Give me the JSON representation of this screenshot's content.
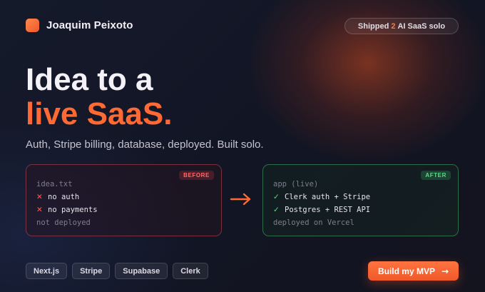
{
  "header": {
    "brand": "Joaquim Peixoto",
    "pill": {
      "prefix": "Shipped",
      "count": "2",
      "suffix": "AI SaaS solo"
    }
  },
  "hero": {
    "line1": "Idea to a",
    "line2": "live SaaS.",
    "subhead": "Auth, Stripe billing, database, deployed. Built solo."
  },
  "before": {
    "badge": "BEFORE",
    "file": "idea.txt",
    "items": [
      "no auth",
      "no payments"
    ],
    "footer": "not deployed",
    "item_icon": "x-icon"
  },
  "after": {
    "badge": "AFTER",
    "file": "app (live)",
    "items": [
      "Clerk auth + Stripe",
      "Postgres + REST API"
    ],
    "footer": "deployed on Vercel",
    "item_icon": "check-icon"
  },
  "tags": [
    "Next.js",
    "Stripe",
    "Supabase",
    "Clerk"
  ],
  "cta": {
    "label": "Build my MVP",
    "icon": "arrow-right-icon"
  },
  "colors": {
    "accent": "#ff6a34",
    "before_border": "#c84650",
    "after_border": "#46be6e",
    "background": "#131626"
  }
}
